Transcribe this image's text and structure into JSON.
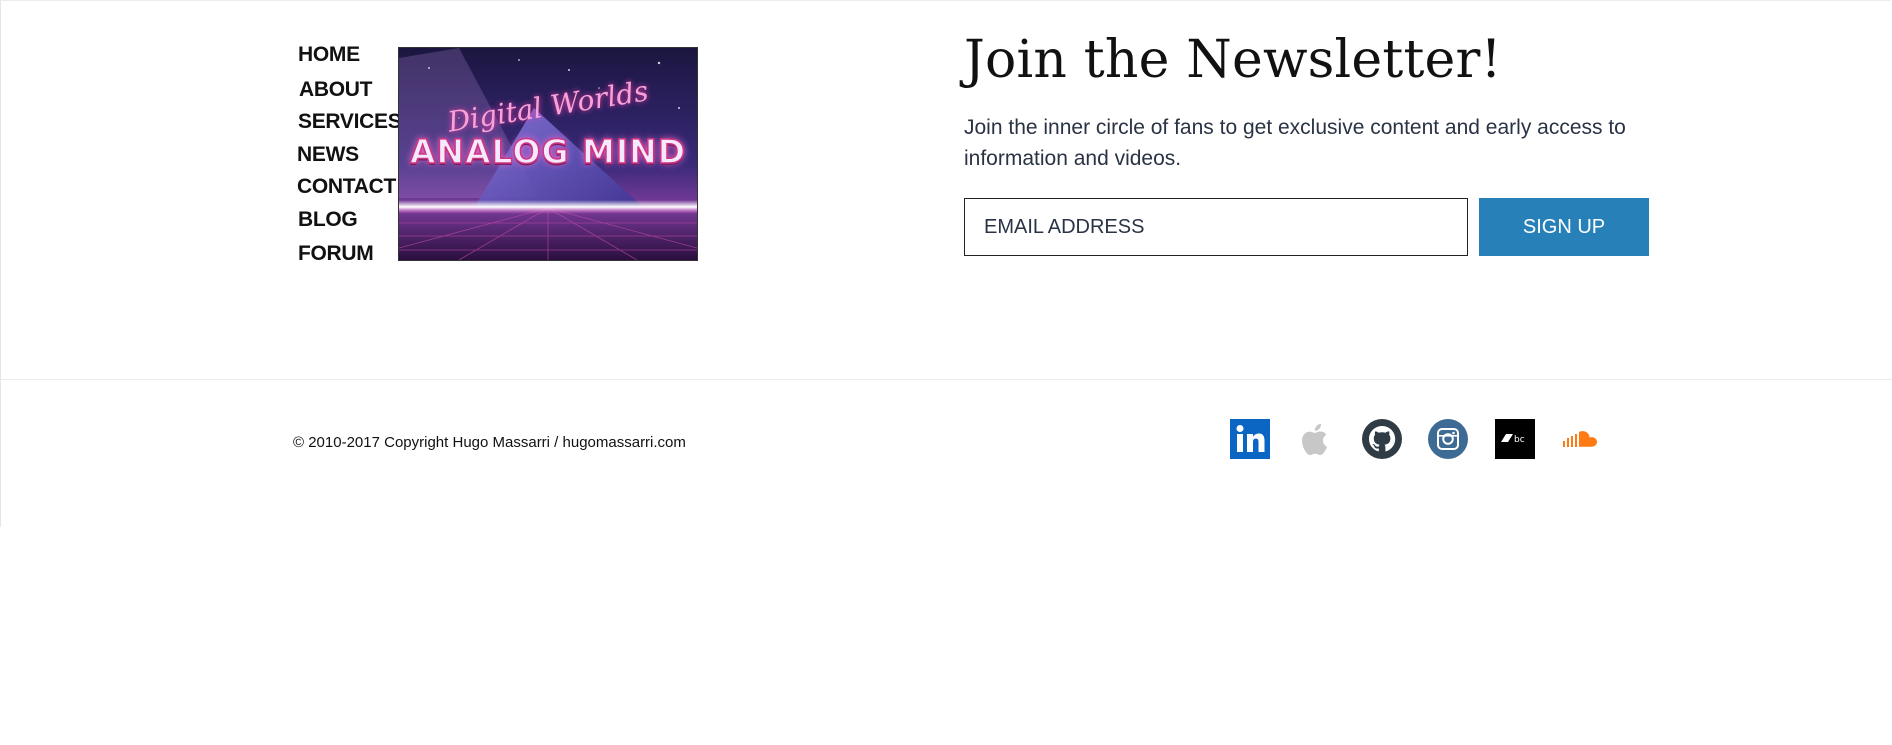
{
  "nav": {
    "items": [
      {
        "label": "HOME"
      },
      {
        "label": "ABOUT"
      },
      {
        "label": "SERVICES"
      },
      {
        "label": "NEWS"
      },
      {
        "label": "CONTACT"
      },
      {
        "label": "BLOG"
      },
      {
        "label": "FORUM"
      }
    ]
  },
  "promo": {
    "line1": "Digital Worlds",
    "line2": "ANALOG MIND"
  },
  "newsletter": {
    "title": "Join the Newsletter!",
    "description": "Join the inner circle of fans to get exclusive content and early access to information and videos.",
    "email_placeholder": "EMAIL ADDRESS",
    "signup_label": "SIGN UP"
  },
  "footer": {
    "copyright": "© 2010-2017 Copyright Hugo Massarri / hugomassarri.com",
    "social": [
      {
        "icon": "linkedin-icon",
        "color": "#0a66c2"
      },
      {
        "icon": "apple-icon",
        "color": "#c7c7c7"
      },
      {
        "icon": "github-icon",
        "color": "#2f3b45"
      },
      {
        "icon": "instagram-icon",
        "color": "#3e6b94"
      },
      {
        "icon": "bandcamp-icon",
        "color": "#000000"
      },
      {
        "icon": "soundcloud-icon",
        "color": "#ff7a12"
      }
    ]
  },
  "colors": {
    "accent": "#2780b7",
    "text_dark": "#111111",
    "text_body": "#2a3344"
  }
}
